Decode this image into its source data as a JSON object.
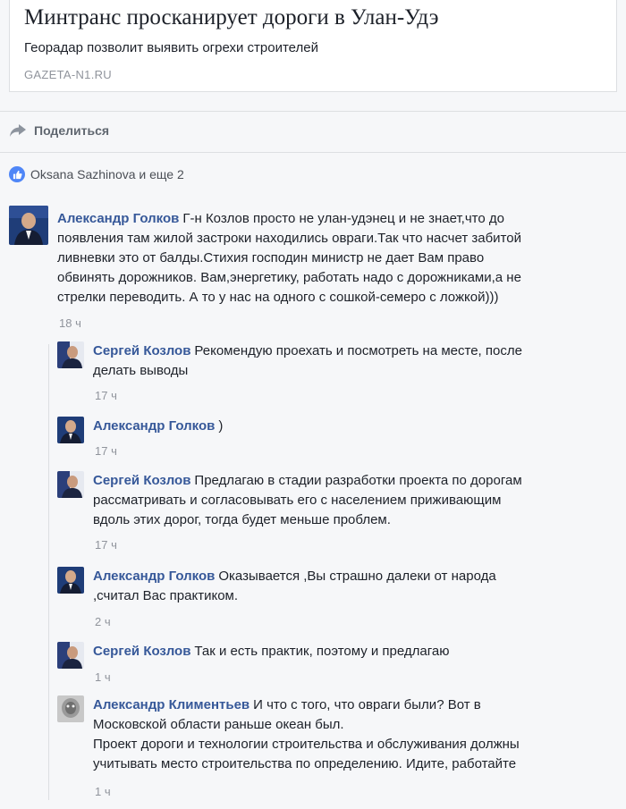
{
  "link": {
    "title": "Минтранс просканирует дороги в Улан-Удэ",
    "subtitle": "Георадар позволит выявить огрехи строителей",
    "domain": "GAZETA-N1.RU"
  },
  "share": {
    "label": "Поделиться",
    "icon": "share-arrow-icon"
  },
  "likes": {
    "text": "Oksana Sazhinova и еще 2",
    "icon": "like-thumb-icon"
  },
  "comments": [
    {
      "author": "Александр Голков",
      "lines": [
        "Г-н Козлов просто не улан-удэнец и не знает,что до",
        "появления там жилой застроки находились овраги.Так что насчет забитой",
        "ливневки это от балды.Стихия господин министр не дает Вам право",
        "обвинять дорожников. Вам,энергетику, работать надо с дорожниками,а не",
        "стрелки переводить. А то у нас на одного с сошкой-семеро с ложкой)))"
      ],
      "time": "18 ч"
    }
  ],
  "replies": [
    {
      "author": "Сергей Козлов",
      "lines": [
        "Рекомендую проехать и посмотреть на месте, после",
        "делать выводы"
      ],
      "time": "17 ч"
    },
    {
      "author": "Александр Голков",
      "lines": [
        ")"
      ],
      "time": "17 ч"
    },
    {
      "author": "Сергей Козлов",
      "lines": [
        "Предлагаю в стадии разработки проекта по дорогам",
        "рассматривать и согласовывать его с населением приживающим",
        "вдоль этих дорог, тогда будет меньше проблем."
      ],
      "time": "17 ч"
    },
    {
      "author": "Александр Голков",
      "lines": [
        "Оказывается ,Вы страшно далеки от народа",
        ",считал Вас практиком."
      ],
      "time": "2 ч"
    },
    {
      "author": "Сергей Козлов",
      "lines": [
        "Так и есть практик, поэтому и предлагаю"
      ],
      "time": "1 ч"
    },
    {
      "author": "Александр Климентьев",
      "lines": [
        "И что с того, что овраги были? Вот в",
        "Московской области раньше океан был.",
        "Проект дороги и технологии строительства и обслуживания должны",
        "учитывать место строительства по определению. Идите, работайте"
      ],
      "time": "1 ч"
    }
  ],
  "colors": {
    "author": "#365899",
    "meta": "#90949c",
    "like": "#4f86f7"
  }
}
